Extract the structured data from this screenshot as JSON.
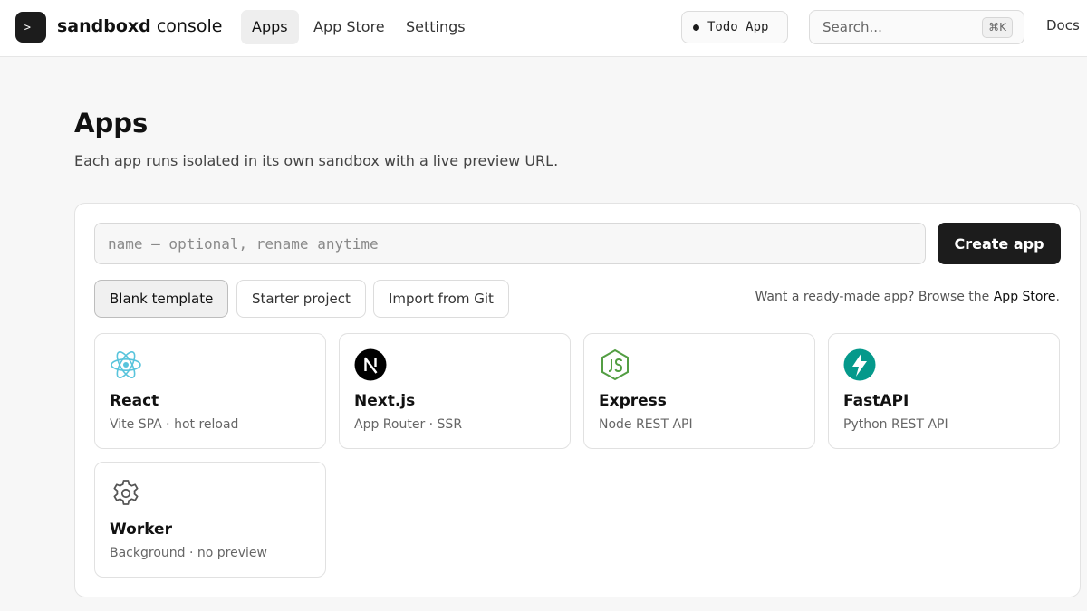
{
  "brand": {
    "logo_glyph": ">_",
    "name_bold": "sandboxd",
    "name_rest": " console"
  },
  "nav": {
    "items": [
      {
        "label": "Apps",
        "active": true
      },
      {
        "label": "App Store",
        "active": false
      },
      {
        "label": "Settings",
        "active": false
      }
    ]
  },
  "env": {
    "label": "Todo App"
  },
  "search": {
    "placeholder": "Search...",
    "shortcut": "⌘K"
  },
  "docs": {
    "label": "Docs"
  },
  "page": {
    "title": "Apps",
    "subtitle": "Each app runs isolated in its own sandbox with a live preview URL."
  },
  "create": {
    "name_placeholder": "name — optional, rename anytime",
    "button_label": "Create app"
  },
  "source_options": [
    {
      "label": "Blank template",
      "selected": true
    },
    {
      "label": "Starter project",
      "selected": false
    },
    {
      "label": "Import from Git",
      "selected": false
    }
  ],
  "hint": {
    "text": "Want a ready-made app? Browse the ",
    "link": "App Store",
    "suffix": "."
  },
  "templates": [
    {
      "title": "React",
      "desc": "Vite SPA · hot reload",
      "icon": "react-icon",
      "color": "#58c4dc"
    },
    {
      "title": "Next.js",
      "desc": "App Router · SSR",
      "icon": "nextjs-icon",
      "color": "#000000"
    },
    {
      "title": "Express",
      "desc": "Node REST API",
      "icon": "nodejs-icon",
      "color": "#539e43"
    },
    {
      "title": "FastAPI",
      "desc": "Python REST API",
      "icon": "fastapi-icon",
      "color": "#05998b"
    },
    {
      "title": "Worker",
      "desc": "Background · no preview",
      "icon": "gear-icon",
      "color": "#555555"
    }
  ]
}
